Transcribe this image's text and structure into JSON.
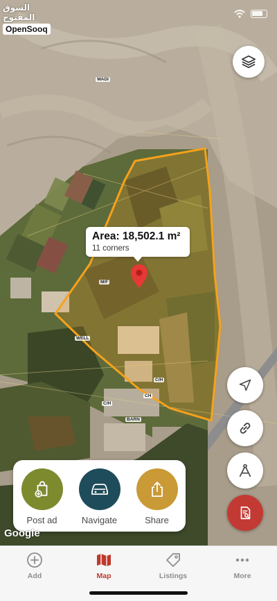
{
  "brand": {
    "arabic": "السوق المفتوح",
    "english": "OpenSooq"
  },
  "map": {
    "area": {
      "title": "Area: 18,502.1 m²",
      "corners": "11 corners"
    },
    "labels": {
      "wadi": "WADI",
      "mf": "M/F",
      "well": "WELL",
      "ch1": "C/H",
      "ch2": "CH",
      "ch3": "C/H",
      "barn": "BARN"
    },
    "attribution": "Google"
  },
  "actions": [
    {
      "label": "Post ad",
      "icon": "post-ad-icon",
      "color": "#7d8a2e"
    },
    {
      "label": "Navigate",
      "icon": "car-icon",
      "color": "#1f4c5a"
    },
    {
      "label": "Share",
      "icon": "share-icon",
      "color": "#c99a35"
    }
  ],
  "tabs": [
    {
      "label": "Add",
      "icon": "plus-circle-icon",
      "active": false
    },
    {
      "label": "Map",
      "icon": "map-icon",
      "active": true
    },
    {
      "label": "Listings",
      "icon": "tag-icon",
      "active": false
    },
    {
      "label": "More",
      "icon": "more-dots-icon",
      "active": false
    }
  ],
  "colors": {
    "accent": "#c0392b",
    "polygon": "#f5a21b",
    "report_button": "#c33a34"
  }
}
